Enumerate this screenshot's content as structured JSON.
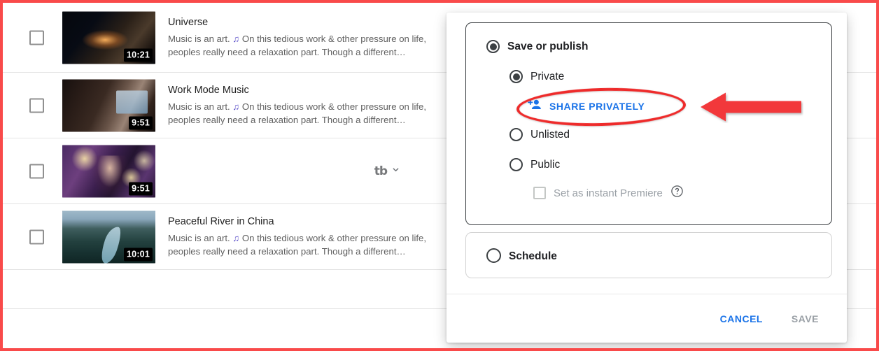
{
  "annotation": {
    "highlight_color": "#ee2b2b",
    "ellipse_target": "SHARE PRIVATELY",
    "arrow_direction": "left"
  },
  "video_list": {
    "rows": [
      {
        "checkbox_checked": false,
        "duration": "10:21",
        "title": "Universe",
        "description_before": "Music is an art. ",
        "description_note": "♫",
        "description_after": " On this tedious work & other pressure on life, peoples really need a relaxation part. Though a different…",
        "thumbnail": "universe-thumbnail",
        "has_tubebuddy_menu": false
      },
      {
        "checkbox_checked": false,
        "duration": "9:51",
        "title": "Work Mode Music",
        "description_before": "Music is an art. ",
        "description_note": "♫",
        "description_after": " On this tedious work & other pressure on life, peoples really need a relaxation part. Though a different…",
        "thumbnail": "work-mode-music-thumbnail",
        "has_tubebuddy_menu": false
      },
      {
        "checkbox_checked": false,
        "duration": "9:51",
        "title": "",
        "description_before": "",
        "description_note": "",
        "description_after": "",
        "thumbnail": "party-sparkler-thumbnail",
        "has_tubebuddy_menu": true,
        "tubebuddy_label": "tb"
      },
      {
        "checkbox_checked": false,
        "duration": "10:01",
        "title": "Peaceful River in China",
        "description_before": "Music is an art. ",
        "description_note": "♫",
        "description_after": " On this tedious work & other pressure on life, peoples really need a relaxation part. Though a different…",
        "thumbnail": "peaceful-river-thumbnail",
        "has_tubebuddy_menu": false
      }
    ]
  },
  "dialog": {
    "visibility_card": {
      "save_or_publish": {
        "label": "Save or publish",
        "selected": true
      },
      "options": [
        {
          "label": "Private",
          "selected": true
        },
        {
          "label": "Unlisted",
          "selected": false
        },
        {
          "label": "Public",
          "selected": false
        }
      ],
      "share_privately": {
        "label": "SHARE PRIVATELY",
        "icon": "person-add-icon",
        "color": "#1a73e8"
      },
      "instant_premiere": {
        "label": "Set as instant Premiere",
        "checked": false,
        "disabled": true,
        "help_icon": "help-circle-icon"
      }
    },
    "schedule_card": {
      "label": "Schedule",
      "selected": false
    },
    "footer": {
      "cancel_label": "CANCEL",
      "cancel_color": "#1a73e8",
      "save_label": "SAVE",
      "save_color": "#9aa0a6",
      "save_disabled": true
    }
  }
}
